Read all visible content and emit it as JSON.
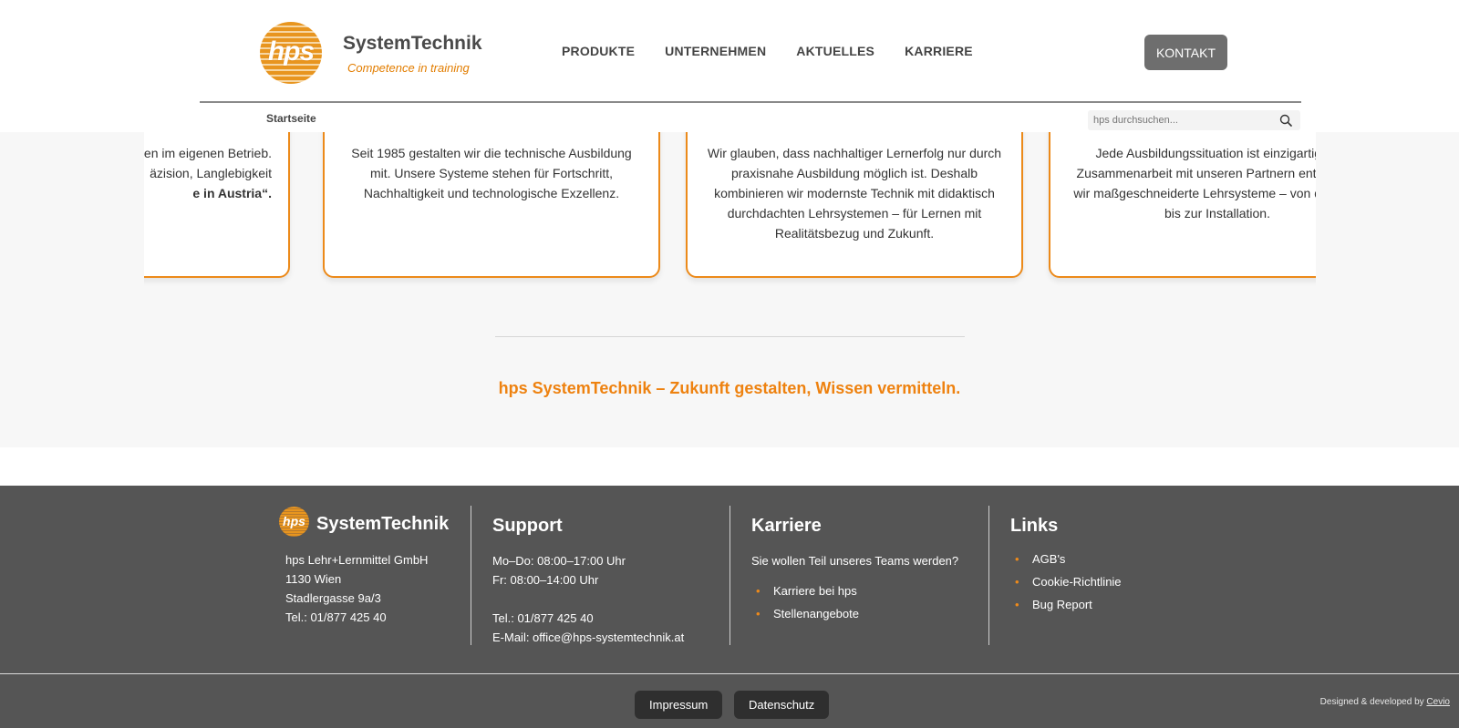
{
  "header": {
    "logo_text": "hps",
    "brand_name": "SystemTechnik",
    "tagline": "Competence in training",
    "nav": [
      "PRODUKTE",
      "UNTERNEHMEN",
      "AKTUELLES",
      "KARRIERE"
    ],
    "contact_label": "KONTAKT",
    "breadcrumb": "Startseite",
    "search_placeholder": "hps durchsuchen..."
  },
  "cards": [
    {
      "lines": [
        "en im eigenen Betrieb.",
        "äzision, Langlebigkeit"
      ],
      "bold_part": "e in Austria",
      "after_bold": "“."
    },
    {
      "text": "Seit 1985 gestalten wir die technische Ausbildung mit. Unsere Systeme stehen für Fortschritt, Nachhaltigkeit und technologische Exzellenz."
    },
    {
      "text": "Wir glauben, dass nachhaltiger Lernerfolg nur durch praxisnahe Ausbildung möglich ist. Deshalb kombinieren wir modernste Technik mit didaktisch durchdachten Lehrsystemen – für Lernen mit Realitätsbezug und Zukunft."
    },
    {
      "text": "Jede Ausbildungssituation ist einzigartig. In Zusammenarbeit mit unseren Partnern entwickeln wir maßgeschneiderte Lehrsysteme – von der Idee bis zur Installation."
    }
  ],
  "slogan": "hps SystemTechnik – Zukunft gestalten, Wissen vermitteln.",
  "footer": {
    "logo_text": "hps",
    "brand_name": "SystemTechnik",
    "address": [
      "hps Lehr+Lernmittel GmbH",
      "1130 Wien",
      "Stadlergasse 9a/3",
      "Tel.: 01/877 425 40"
    ],
    "support": {
      "title": "Support",
      "hours": [
        "Mo–Do: 08:00–17:00 Uhr",
        "Fr: 08:00–14:00 Uhr"
      ],
      "phone": "Tel.: 01/877 425 40",
      "email": "E-Mail: office@hps-systemtechnik.at"
    },
    "karriere": {
      "title": "Karriere",
      "intro": "Sie wollen Teil unseres Teams werden?",
      "links": [
        "Karriere bei hps",
        "Stellenangebote"
      ]
    },
    "links": {
      "title": "Links",
      "items": [
        "AGB's",
        "Cookie-Richtlinie",
        "Bug Report"
      ]
    }
  },
  "bottom": {
    "impressum": "Impressum",
    "datenschutz": "Datenschutz",
    "credit_prefix": "Designed & developed by",
    "credit_link": "Cevio"
  },
  "colors": {
    "accent": "#ee8210",
    "footer_bg": "#555555",
    "contact_btn": "#6e6e6e"
  }
}
